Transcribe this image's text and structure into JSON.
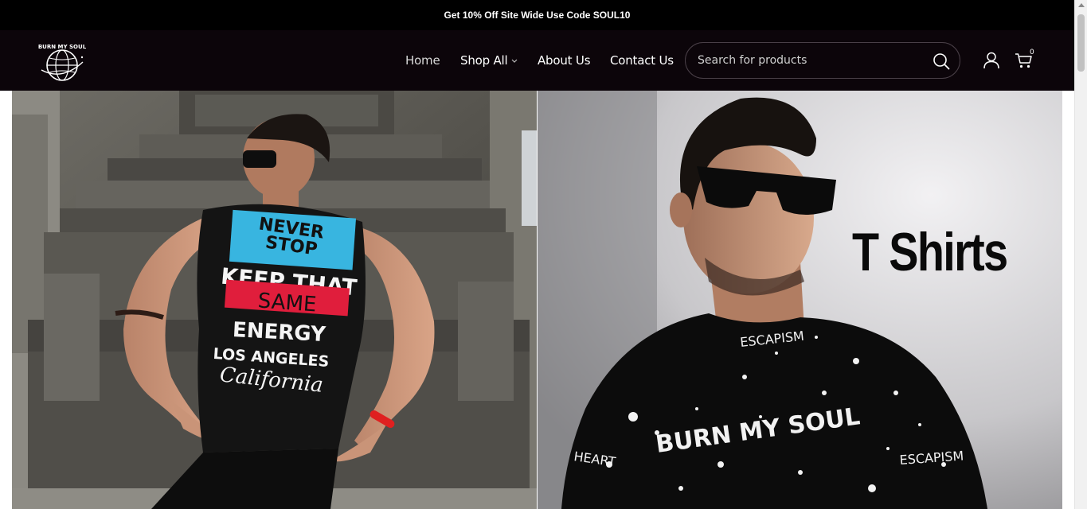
{
  "announcement": "Get 10% Off Site Wide Use Code SOUL10",
  "header": {
    "logo_text": "BURN MY SOUL",
    "nav": {
      "home": "Home",
      "shop_all": "Shop All",
      "about": "About Us",
      "contact": "Contact Us"
    },
    "search": {
      "placeholder": "Search for products"
    },
    "cart_count": "0"
  },
  "banners": {
    "left": {
      "shirt_lines": [
        "NEVER",
        "STOP",
        "KEEP THAT",
        "SAME",
        "ENERGY",
        "LOS ANGELES",
        "California"
      ]
    },
    "right": {
      "title": "T Shirts",
      "shirt_words": [
        "ESCAPISM",
        "BURN MY SOUL",
        "HEART",
        "ESCAPISM"
      ]
    }
  },
  "colors": {
    "topbar": "#000000",
    "header": "#0c050a",
    "shirt_blue": "#38b5e0",
    "shirt_red": "#e01e3c"
  }
}
